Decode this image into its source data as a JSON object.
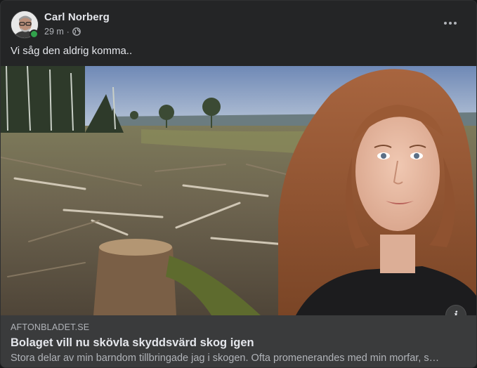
{
  "post": {
    "author": "Carl Norberg",
    "time": "29 m",
    "separator": "·",
    "privacy_icon": "globe-icon",
    "text": "Vi såg den aldrig komma.."
  },
  "link": {
    "source": "AFTONBLADET.SE",
    "title": "Bolaget vill nu skövla skyddsvärd skog igen",
    "description": "Stora delar av min barndom tillbringade jag i skogen. Ofta promenerandes med min morfar, s…",
    "info_label": "i"
  },
  "colors": {
    "card_bg": "#242526",
    "preview_bg": "#3a3b3c",
    "online": "#31a24c"
  }
}
